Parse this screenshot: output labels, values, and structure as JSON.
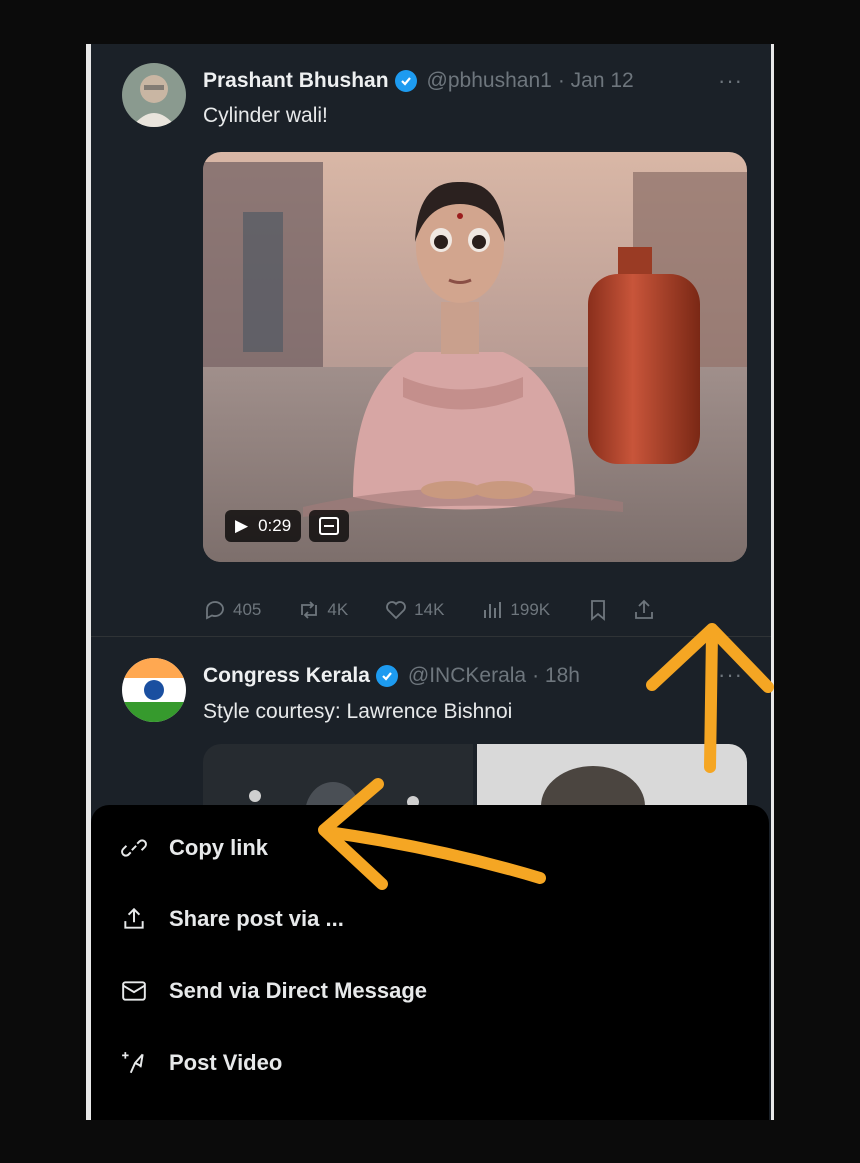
{
  "post1": {
    "author_name": "Prashant Bhushan",
    "handle": "@pbhushan1",
    "date": "· Jan 12",
    "more": "···",
    "text": "Cylinder wali!",
    "video_time": "0:29",
    "actions": {
      "replies": "405",
      "reposts": "4K",
      "likes": "14K",
      "views": "199K"
    }
  },
  "post2": {
    "author_name": "Congress Kerala",
    "handle": "@INCKerala",
    "date": "· 18h",
    "more": "···",
    "text": "Style courtesy: Lawrence Bishnoi"
  },
  "share_menu": {
    "items": [
      {
        "label": "Copy link",
        "icon": "link-icon"
      },
      {
        "label": "Share post via ...",
        "icon": "share-icon"
      },
      {
        "label": "Send via Direct Message",
        "icon": "mail-icon"
      },
      {
        "label": "Post Video",
        "icon": "post-video-icon"
      }
    ]
  },
  "colors": {
    "background": "#1b2128",
    "menu_background": "#000000",
    "verified_blue": "#1d9bf0",
    "annotation_orange": "#f5a623",
    "muted_text": "#6e767d"
  }
}
